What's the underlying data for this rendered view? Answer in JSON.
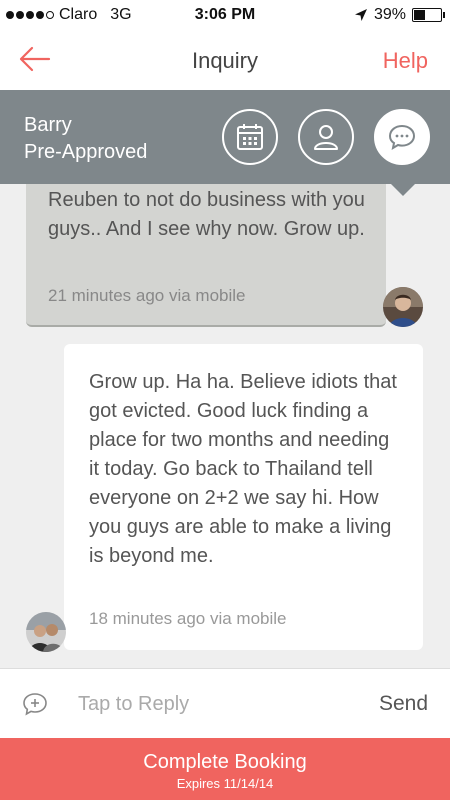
{
  "status_bar": {
    "carrier": "Claro",
    "network": "3G",
    "time": "3:06 PM",
    "battery_text": "39%",
    "battery_level": 0.39
  },
  "nav": {
    "title": "Inquiry",
    "help_label": "Help",
    "back_icon": "arrow-left-icon"
  },
  "header": {
    "guest_name": "Barry",
    "status": "Pre-Approved",
    "buttons": [
      "calendar-icon",
      "profile-icon",
      "message-icon"
    ]
  },
  "messages": [
    {
      "text": "Reuben to not do business with you guys.. And I see why now. Grow up.",
      "meta": "21 minutes ago via mobile"
    },
    {
      "text": "Grow up.  Ha ha. Believe idiots that got evicted.  Good luck finding a place for two months and needing it today. Go back to Thailand tell everyone on 2+2 we say hi. How you guys are able to make a living is beyond me.",
      "meta": "18 minutes ago via mobile"
    }
  ],
  "reply": {
    "placeholder": "Tap to Reply",
    "send_label": "Send"
  },
  "footer": {
    "cta": "Complete Booking",
    "expires": "Expires 11/14/14"
  },
  "colors": {
    "accent": "#f0645f",
    "header_bg": "#7f878b",
    "out_bubble": "#d3d4d1",
    "page_bg": "#efefef"
  }
}
